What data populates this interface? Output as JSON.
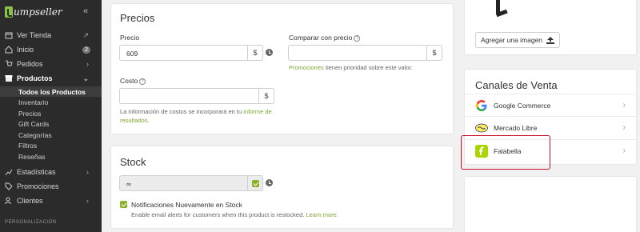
{
  "brand": {
    "name": "umpseller"
  },
  "sidebar": {
    "items": [
      {
        "label": "Ver Tienda"
      },
      {
        "label": "Inicio",
        "badge": "2"
      },
      {
        "label": "Pedidos"
      },
      {
        "label": "Productos"
      },
      {
        "label": "Estadísticas"
      },
      {
        "label": "Promociones"
      },
      {
        "label": "Clientes"
      }
    ],
    "sub_items": [
      "Todos los Productos",
      "Inventario",
      "Precios",
      "Gift Cards",
      "Categorías",
      "Filtros",
      "Reseñas"
    ],
    "section_title": "PERSONALIZACIÓN"
  },
  "precios": {
    "title": "Precios",
    "precio_label": "Precio",
    "precio_value": "609",
    "currency": "$",
    "comparar_label": "Comparar con precio",
    "comparar_value": "",
    "promo_note_link": "Promociones",
    "promo_note_text": " tienen prioridad sobre este valor.",
    "costo_label": "Costo",
    "costo_value": "",
    "costo_note_text": "La información de costos se incorporará en tu ",
    "costo_note_link": "informe de resultados",
    "costo_note_end": "."
  },
  "stock": {
    "title": "Stock",
    "value": "∞",
    "notify_label": "Notificaciones Nuevamente en Stock",
    "notify_desc": "Enable email alerts for customers when this product is restocked. ",
    "notify_link": "Learn more."
  },
  "images": {
    "add_label": "Agregar una imagen"
  },
  "canales": {
    "title": "Canales de Venta",
    "items": [
      {
        "label": "Google Commerce"
      },
      {
        "label": "Mercado Libre"
      },
      {
        "label": "Falabella"
      }
    ]
  },
  "colors": {
    "accent": "#8cb12b",
    "highlight": "#c8102e",
    "sidebar": "#2b2b2b"
  }
}
